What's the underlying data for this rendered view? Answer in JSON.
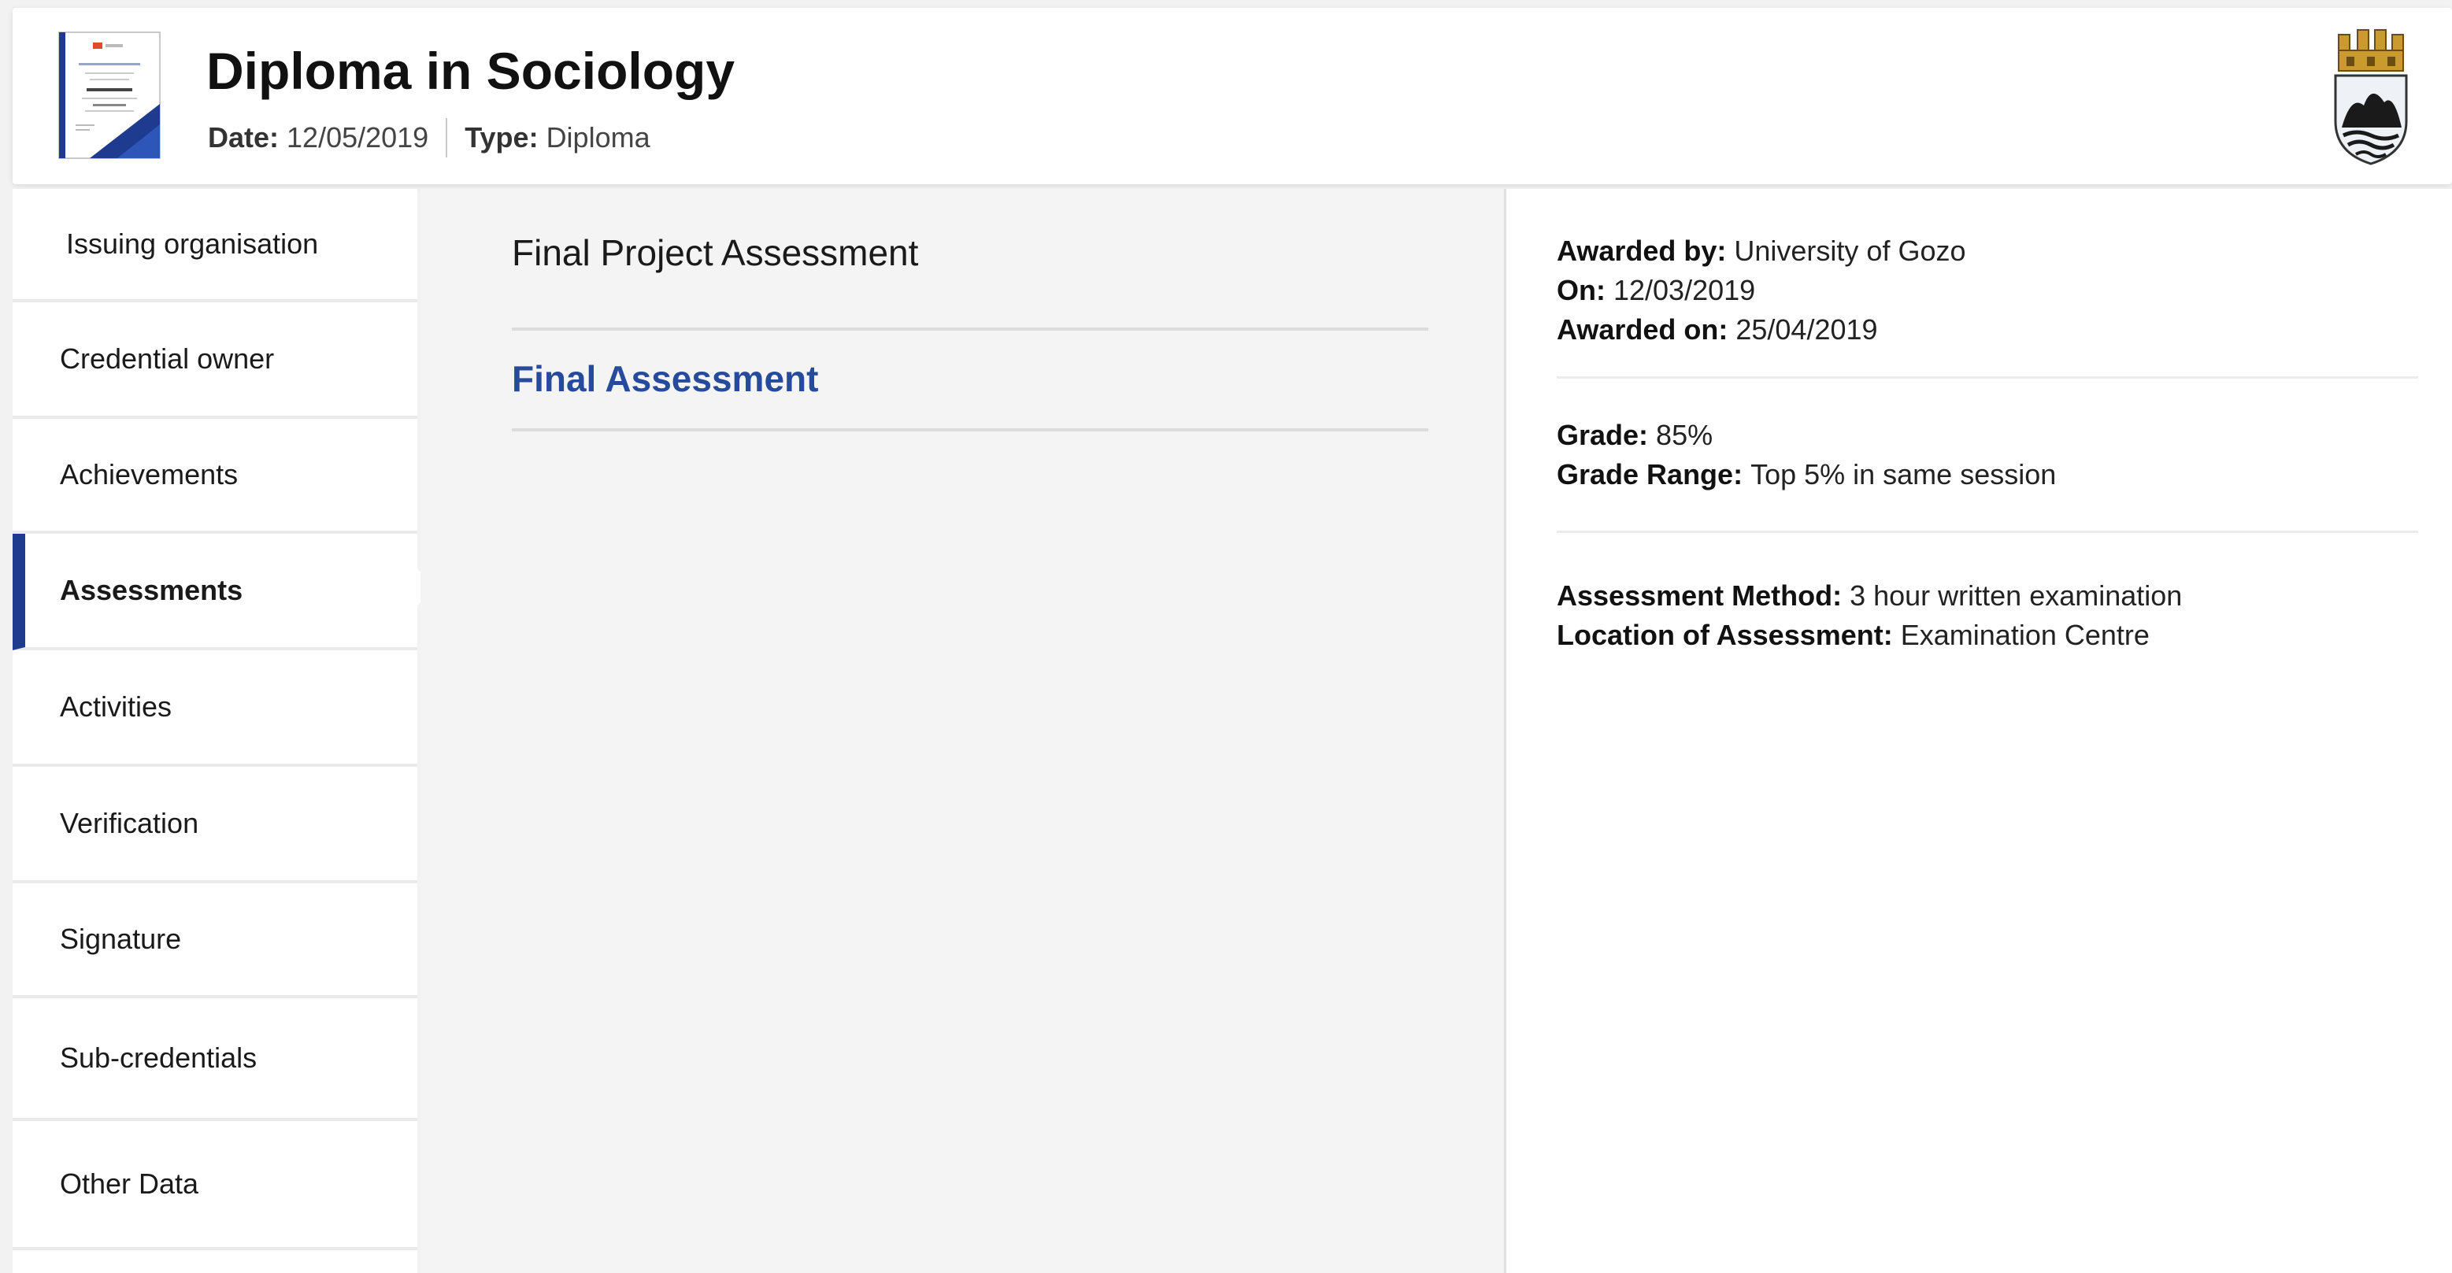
{
  "header": {
    "title": "Diploma in Sociology",
    "date_label": "Date:",
    "date_value": "12/05/2019",
    "type_label": "Type:",
    "type_value": "Diploma"
  },
  "icons": {
    "certificate": "certificate-thumbnail-icon",
    "crest": "university-crest-icon"
  },
  "nav": {
    "items": [
      {
        "label": "Issuing organisation"
      },
      {
        "label": "Credential owner"
      },
      {
        "label": "Achievements"
      },
      {
        "label": "Assessments"
      },
      {
        "label": "Activities"
      },
      {
        "label": "Verification"
      },
      {
        "label": "Signature"
      },
      {
        "label": "Sub-credentials"
      },
      {
        "label": "Other Data"
      }
    ],
    "active": "Assessments"
  },
  "assessments": {
    "heading": "Final Project Assessment",
    "selected": "Final Assessment"
  },
  "details": {
    "awarded_by_label": "Awarded by:",
    "awarded_by_value": "University of Gozo",
    "on_label": "On:",
    "on_value": "12/03/2019",
    "awarded_on_label": "Awarded on:",
    "awarded_on_value": "25/04/2019",
    "grade_label": "Grade:",
    "grade_value": "85%",
    "grade_range_label": "Grade Range:",
    "grade_range_value": "Top 5% in same session",
    "method_label": "Assessment Method:",
    "method_value": "3 hour written examination",
    "location_label": "Location of Assessment:",
    "location_value": "Examination Centre"
  },
  "colors": {
    "accent": "#1f3b8f",
    "link": "#274b9c"
  }
}
